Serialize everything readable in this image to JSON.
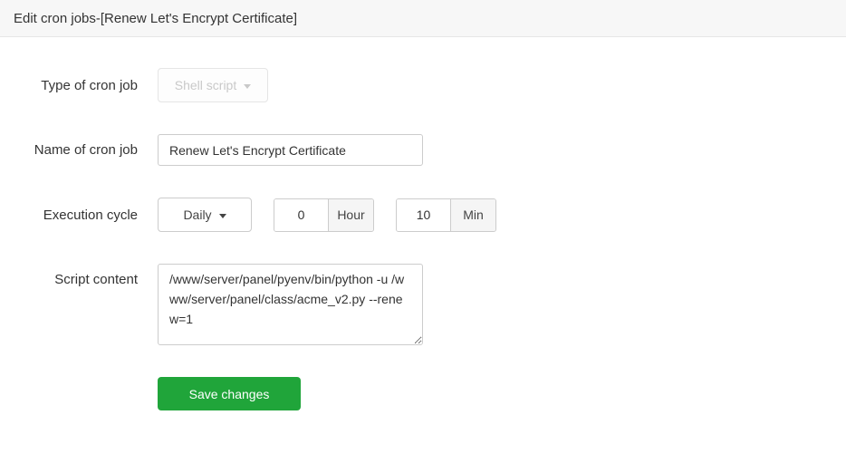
{
  "header": {
    "title": "Edit cron jobs-[Renew Let's Encrypt Certificate]"
  },
  "form": {
    "type": {
      "label": "Type of cron job",
      "value": "Shell script",
      "disabled": true
    },
    "name": {
      "label": "Name of cron job",
      "value": "Renew Let's Encrypt Certificate"
    },
    "cycle": {
      "label": "Execution cycle",
      "period": "Daily",
      "hour": "0",
      "hour_unit": "Hour",
      "minute": "10",
      "minute_unit": "Min"
    },
    "script": {
      "label": "Script content",
      "value": "/www/server/panel/pyenv/bin/python -u /www/server/panel/class/acme_v2.py --renew=1"
    },
    "save_label": "Save changes"
  },
  "colors": {
    "accent_green": "#20a53a",
    "header_bg": "#f7f7f7",
    "border": "#cccccc",
    "addon_bg": "#f5f5f5",
    "disabled_text": "#c9c9c9"
  }
}
